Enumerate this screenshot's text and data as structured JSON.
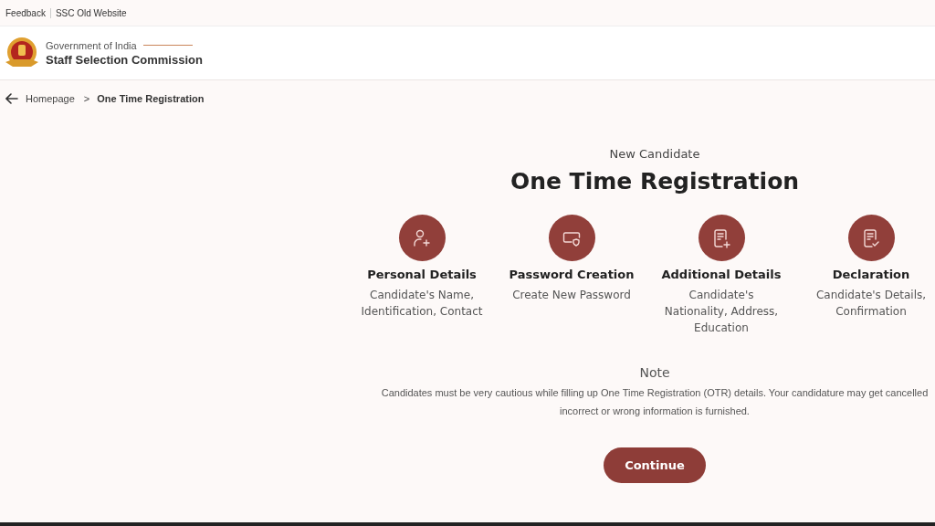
{
  "top_links": [
    "Feedback",
    "SSC Old Website"
  ],
  "header": {
    "subtitle": "Government of India",
    "title": "Staff Selection Commission"
  },
  "breadcrumb": [
    "Homepage",
    "One Time Registration"
  ],
  "breadcrumb_separator": ">",
  "eyebrow": "New Candidate",
  "heading": "One Time Registration",
  "steps": [
    {
      "kind": "person",
      "title": "Personal Details",
      "lines": [
        "Candidate's Name,",
        "Identification, Contact"
      ]
    },
    {
      "kind": "password",
      "title": "Password Creation",
      "lines": [
        "Create New Password"
      ]
    },
    {
      "kind": "document-add",
      "title": "Additional Details",
      "lines": [
        "Candidate's",
        "Nationality, Address,",
        "Education"
      ]
    },
    {
      "kind": "document-check",
      "title": "Declaration",
      "lines": [
        "Candidate's Details,",
        "Confirmation"
      ]
    }
  ],
  "note": {
    "title": "Note",
    "lines": [
      "Candidates must be very cautious while filling up One Time Registration (OTR) details. Your candidature may get cancelled",
      "incorrect or wrong information is furnished."
    ]
  },
  "continue_button": "Continue"
}
